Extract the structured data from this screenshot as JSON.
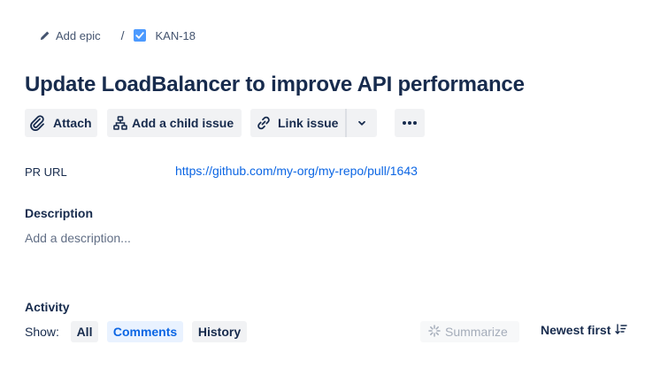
{
  "breadcrumb": {
    "add_epic": "Add epic",
    "separator": "/",
    "issue_key": "KAN-18"
  },
  "issue": {
    "title": "Update LoadBalancer to improve API performance"
  },
  "toolbar": {
    "attach": "Attach",
    "add_child": "Add a child issue",
    "link_issue": "Link issue"
  },
  "fields": {
    "pr_url_label": "PR URL",
    "pr_url_value": "https://github.com/my-org/my-repo/pull/1643"
  },
  "description": {
    "heading": "Description",
    "placeholder": "Add a description..."
  },
  "activity": {
    "heading": "Activity",
    "show_label": "Show:",
    "filters": [
      "All",
      "Comments",
      "History"
    ],
    "selected_filter": "Comments",
    "summarize": "Summarize",
    "sort": "Newest first"
  },
  "colors": {
    "link": "#0c66e4",
    "text": "#172b4d",
    "button_bg": "#f1f2f4",
    "selected_bg": "#e9f2ff",
    "checkbox": "#4c9aff"
  },
  "icons": [
    "pencil-icon",
    "checkbox-icon",
    "paperclip-icon",
    "hierarchy-icon",
    "link-icon",
    "chevron-down-icon",
    "more-icon",
    "sparkle-icon",
    "sort-icon"
  ]
}
